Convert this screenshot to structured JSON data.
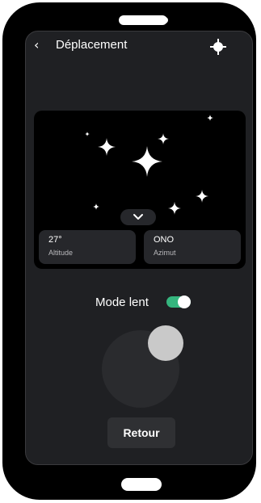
{
  "header": {
    "back_icon": "chevron-left-icon",
    "back_glyph": "‹",
    "title": "Déplacement",
    "locate_icon": "crosshair-target-icon"
  },
  "sky": {
    "expand_icon": "chevron-down-icon"
  },
  "info": {
    "altitude": {
      "value": "27°",
      "label": "Altitude"
    },
    "azimuth": {
      "value": "ONO",
      "label": "Azimut"
    }
  },
  "slow_mode": {
    "label": "Mode lent",
    "enabled": true
  },
  "joystick": {
    "name": "joystick"
  },
  "footer": {
    "back_label": "Retour"
  },
  "colors": {
    "screen_bg": "#1f2023",
    "card_bg": "#26272b",
    "toggle_on": "#35b57e",
    "joystick": "#c9c9c9"
  }
}
